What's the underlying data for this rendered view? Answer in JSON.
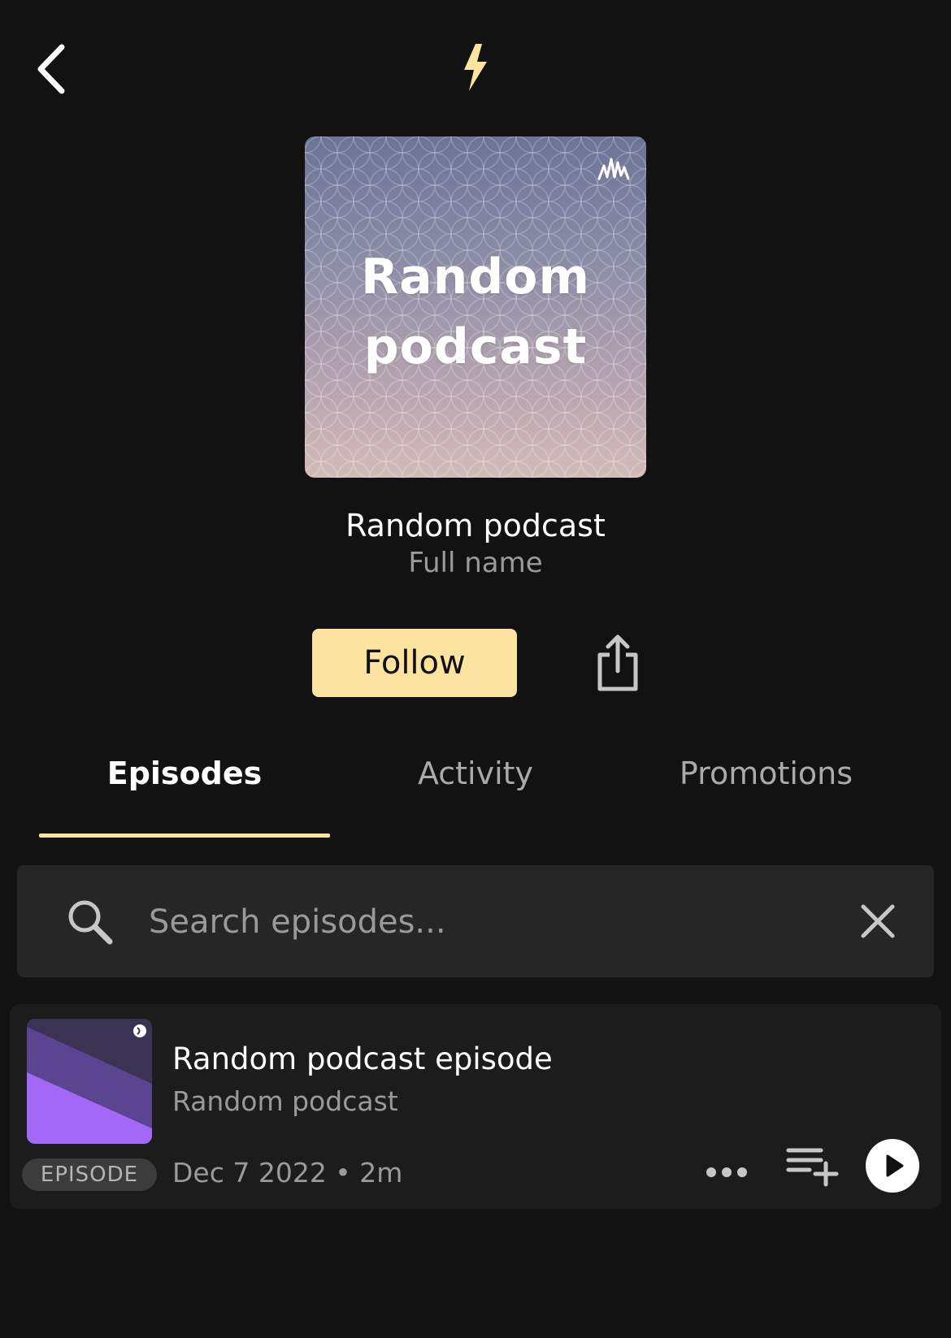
{
  "header": {
    "back_icon": "chevron-left-icon",
    "brand_icon": "lightning-bolt-icon",
    "accent_color": "#FDE3A0"
  },
  "podcast": {
    "cover_title": "Random\npodcast",
    "title": "Random podcast",
    "author": "Full name"
  },
  "actions": {
    "follow_label": "Follow",
    "share_icon": "share-icon"
  },
  "tabs": [
    {
      "label": "Episodes",
      "active": true
    },
    {
      "label": "Activity",
      "active": false
    },
    {
      "label": "Promotions",
      "active": false
    }
  ],
  "search": {
    "placeholder": "Search episodes...",
    "value": ""
  },
  "episodes": [
    {
      "title": "Random podcast episode",
      "podcast": "Random podcast",
      "badge": "EPISODE",
      "meta": "Dec 7 2022 • 2m"
    }
  ]
}
